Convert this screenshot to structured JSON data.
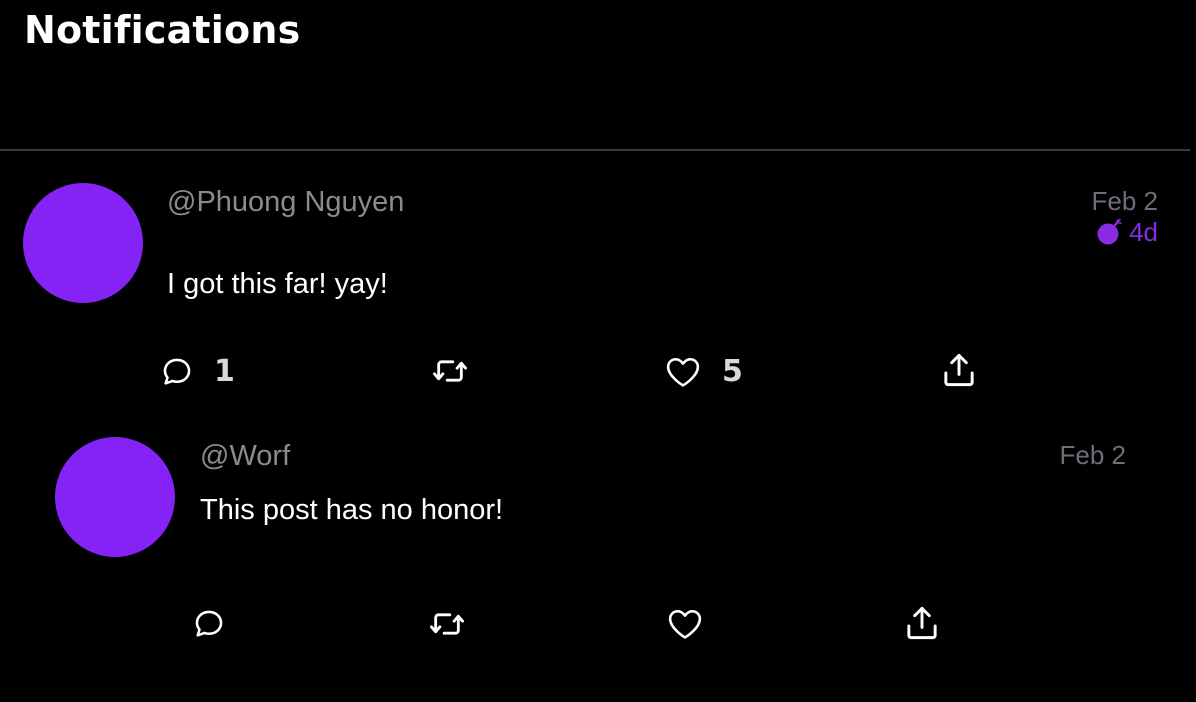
{
  "page": {
    "title": "Notifications"
  },
  "posts": [
    {
      "handle": "@Phuong Nguyen",
      "text": "I got this far! yay!",
      "date": "Feb 2",
      "age": "4d",
      "age_icon": "bomb-icon",
      "avatar_color": "#8522F5",
      "actions": {
        "reply_count": "1",
        "repost_count": "",
        "like_count": "5"
      }
    },
    {
      "handle": "@Worf",
      "text": "This post has no honor!",
      "date": "Feb 2",
      "avatar_color": "#8522F5",
      "actions": {
        "reply_count": "",
        "repost_count": "",
        "like_count": ""
      }
    }
  ],
  "colors": {
    "background": "#000000",
    "accent": "#8A2BE2",
    "muted_text": "#8B8B8B",
    "divider": "#3A3A42"
  }
}
